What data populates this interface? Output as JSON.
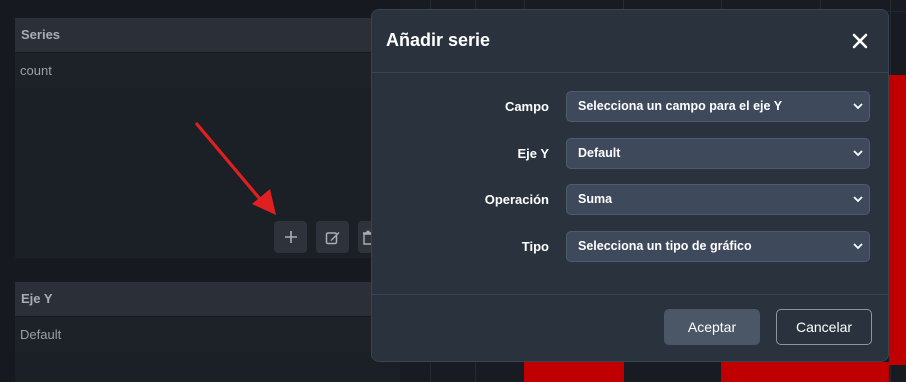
{
  "background": {
    "series_section": {
      "title": "Series",
      "item": "count"
    },
    "axis_section": {
      "title": "Eje Y",
      "item": "Default"
    },
    "toolbar": {
      "add_icon": "plus-icon",
      "edit_icon": "edit-icon",
      "delete_icon": "trash-icon"
    },
    "annotation_color": "#e02020",
    "chart_bar_color": "#c00000"
  },
  "modal": {
    "title": "Añadir serie",
    "close_icon": "close-icon",
    "fields": [
      {
        "label": "Campo",
        "value": "Selecciona un campo para el eje Y"
      },
      {
        "label": "Eje Y",
        "value": "Default"
      },
      {
        "label": "Operación",
        "value": "Suma"
      },
      {
        "label": "Tipo",
        "value": "Selecciona un tipo de gráfico"
      }
    ],
    "accept_label": "Aceptar",
    "cancel_label": "Cancelar"
  }
}
